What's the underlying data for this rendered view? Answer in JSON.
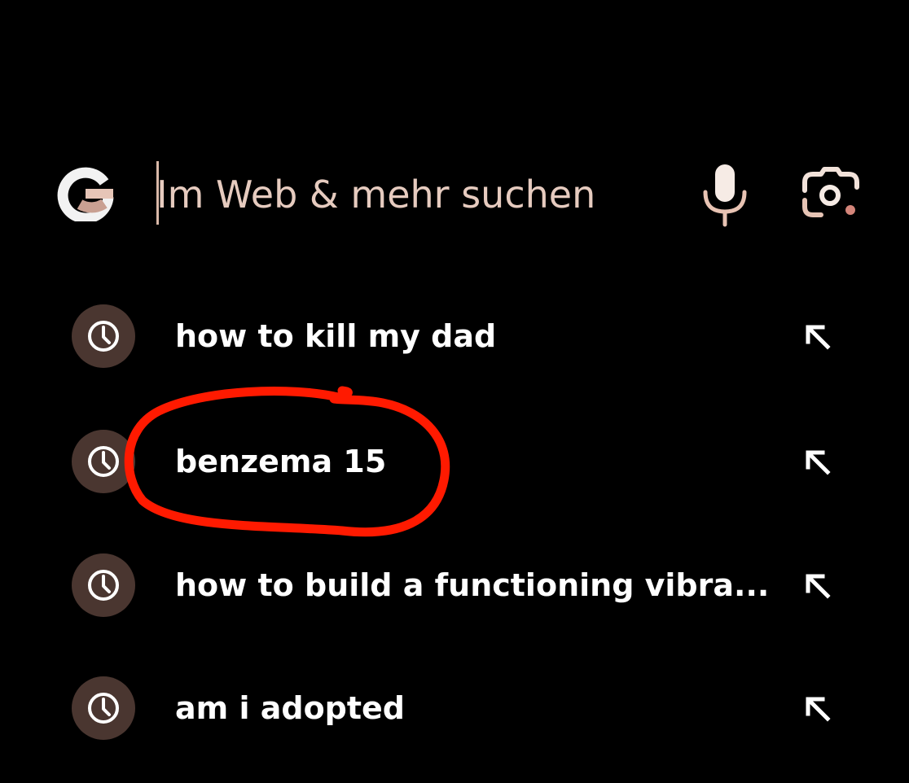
{
  "search": {
    "placeholder": "Im Web & mehr suchen",
    "logo": "google-g-icon",
    "voice_icon": "microphone-icon",
    "lens_icon": "camera-lens-icon"
  },
  "suggestions": [
    {
      "text": "how to kill my dad",
      "icon": "history-clock-icon",
      "action_icon": "arrow-up-left-icon"
    },
    {
      "text": "benzema 15",
      "icon": "history-clock-icon",
      "action_icon": "arrow-up-left-icon"
    },
    {
      "text": "how to build a functioning vibra...",
      "icon": "history-clock-icon",
      "action_icon": "arrow-up-left-icon"
    },
    {
      "text": "am i adopted",
      "icon": "history-clock-icon",
      "action_icon": "arrow-up-left-icon"
    }
  ],
  "colors": {
    "background": "#000000",
    "accent": "#e8c9bb",
    "icon_bg": "#4a3630",
    "text": "#ffffff",
    "annotation": "#ff1a00"
  },
  "annotation": {
    "type": "hand-drawn circle",
    "target": "benzema 15"
  }
}
